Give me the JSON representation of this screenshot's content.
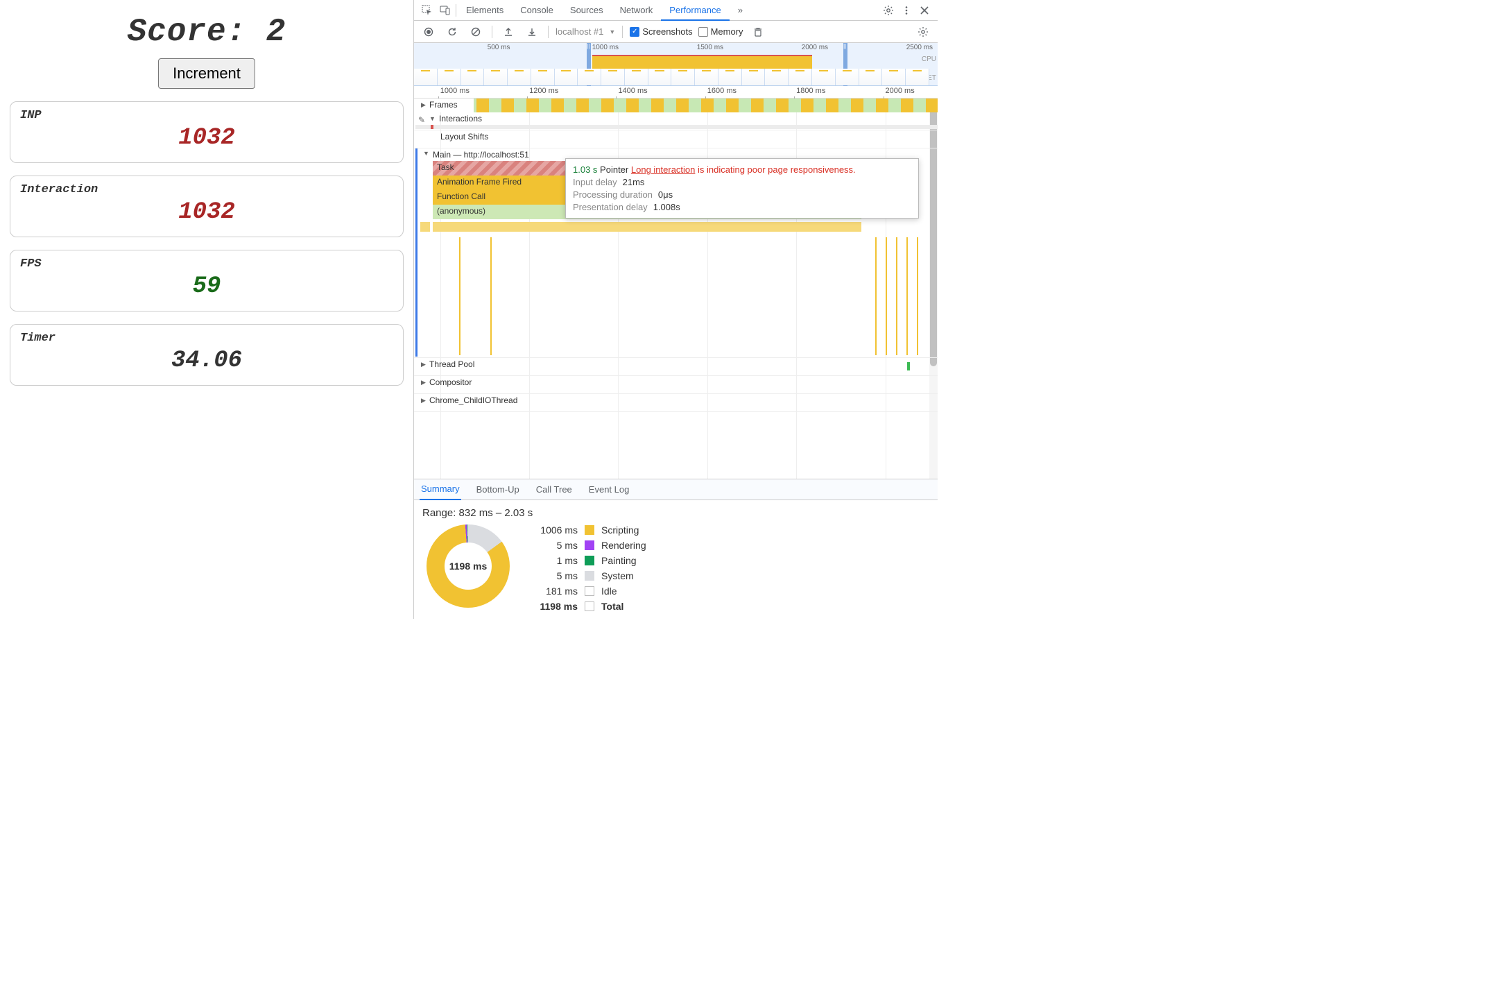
{
  "left": {
    "score_label": "Score: 2",
    "increment_label": "Increment",
    "metrics": {
      "inp": {
        "label": "INP",
        "value": "1032"
      },
      "interaction": {
        "label": "Interaction",
        "value": "1032"
      },
      "fps": {
        "label": "FPS",
        "value": "59"
      },
      "timer": {
        "label": "Timer",
        "value": "34.06"
      }
    }
  },
  "devtools": {
    "tabs": {
      "elements": "Elements",
      "console": "Console",
      "sources": "Sources",
      "network": "Network",
      "performance": "Performance",
      "more": "»"
    },
    "toolbar": {
      "profile_name": "localhost #1",
      "screenshots_label": "Screenshots",
      "memory_label": "Memory"
    }
  },
  "overview": {
    "ticks": {
      "t1": "500 ms",
      "t2": "1000 ms",
      "t3": "1500 ms",
      "t4": "2000 ms",
      "t5": "2500 ms"
    },
    "cpu_label": "CPU",
    "net_label": "NET"
  },
  "timeline": {
    "ticks": {
      "t1": "1000 ms",
      "t2": "1200 ms",
      "t3": "1400 ms",
      "t4": "1600 ms",
      "t5": "1800 ms",
      "t6": "2000 ms"
    },
    "frames_label": "Frames",
    "interactions_label": "Interactions",
    "layout_shifts_label": "Layout Shifts",
    "main_label_prefix": "Main — http://localhost:51",
    "task_label": "Task",
    "afr_label": "Animation Frame Fired",
    "fn_label": "Function Call",
    "anon_label": "(anonymous)",
    "thread_pool_label": "Thread Pool",
    "compositor_label": "Compositor",
    "child_io_label": "Chrome_ChildIOThread"
  },
  "tooltip": {
    "duration": "1.03 s",
    "pointer_word": "Pointer",
    "link_text": "Long interaction",
    "rest_text": " is indicating poor page responsiveness.",
    "rows": {
      "input_delay_label": "Input delay",
      "input_delay_value": "21ms",
      "processing_label": "Processing duration",
      "processing_value": "0μs",
      "presentation_label": "Presentation delay",
      "presentation_value": "1.008s"
    }
  },
  "bottom_tabs": {
    "summary": "Summary",
    "bottom_up": "Bottom-Up",
    "call_tree": "Call Tree",
    "event_log": "Event Log"
  },
  "summary": {
    "range_text": "Range: 832 ms – 2.03 s",
    "donut_center": "1198 ms",
    "legend": {
      "scripting_ms": "1006 ms",
      "scripting": "Scripting",
      "rendering_ms": "5 ms",
      "rendering": "Rendering",
      "painting_ms": "1 ms",
      "painting": "Painting",
      "system_ms": "5 ms",
      "system": "System",
      "idle_ms": "181 ms",
      "idle": "Idle",
      "total_ms": "1198 ms",
      "total": "Total"
    }
  },
  "chart_data": {
    "type": "pie",
    "title": "Range: 832 ms – 2.03 s",
    "series": [
      {
        "name": "Scripting",
        "value_ms": 1006,
        "color": "#f1c232"
      },
      {
        "name": "Rendering",
        "value_ms": 5,
        "color": "#a142f4"
      },
      {
        "name": "Painting",
        "value_ms": 1,
        "color": "#0f9d58"
      },
      {
        "name": "System",
        "value_ms": 5,
        "color": "#dadce0"
      },
      {
        "name": "Idle",
        "value_ms": 181,
        "color": "#ffffff"
      }
    ],
    "total_ms": 1198
  }
}
